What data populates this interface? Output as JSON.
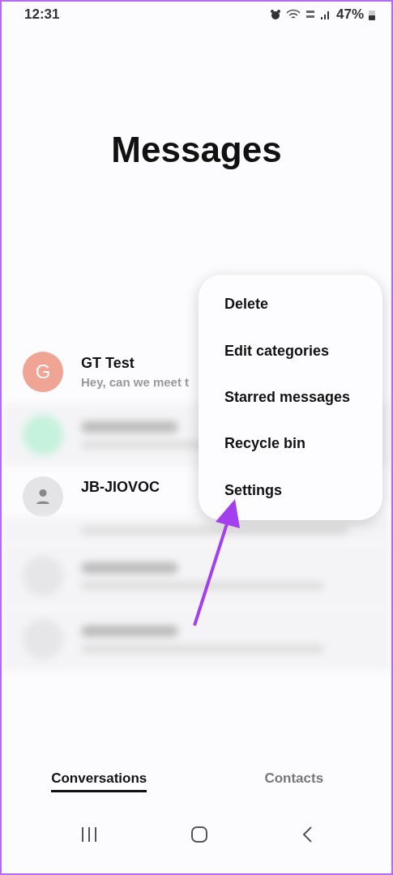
{
  "status_bar": {
    "time": "12:31",
    "battery": "47%"
  },
  "title": "Messages",
  "conversations": [
    {
      "kind": "message",
      "name": "GT Test",
      "preview": "Hey, can we meet t",
      "avatar_letter": "G",
      "color": "#f0a594"
    },
    {
      "kind": "blurred",
      "color": "#c5f2dc"
    },
    {
      "kind": "sender",
      "name": "JB-JIOVOC",
      "color": "#e4e4e6"
    },
    {
      "kind": "blurred",
      "color": "#e6e6e8"
    },
    {
      "kind": "blurred",
      "color": "#e6e6e8"
    }
  ],
  "menu": [
    "Delete",
    "Edit categories",
    "Starred messages",
    "Recycle bin",
    "Settings"
  ],
  "tabs": [
    {
      "label": "Conversations",
      "selected": true
    },
    {
      "label": "Contacts",
      "selected": false
    }
  ]
}
